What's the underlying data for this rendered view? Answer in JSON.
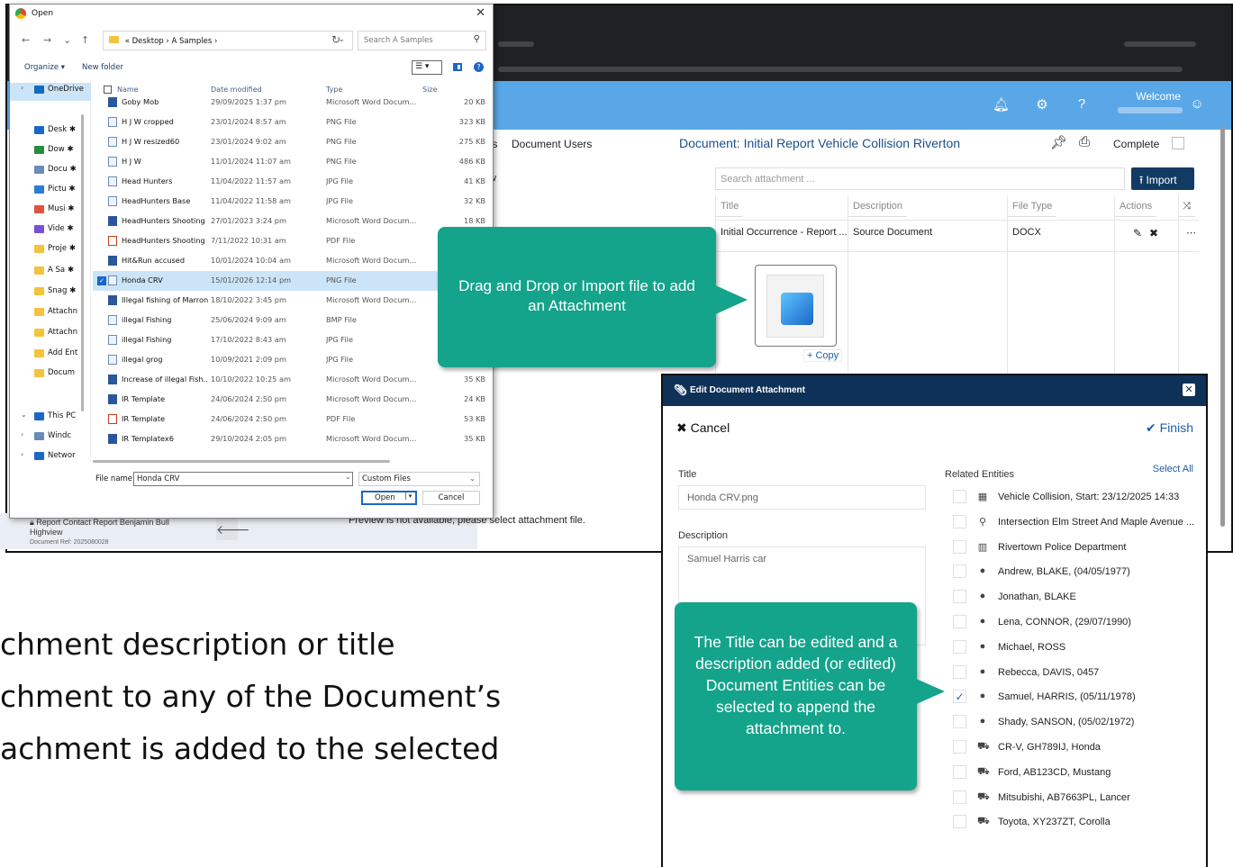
{
  "app": {
    "header": {
      "welcome": "Welcome"
    },
    "tabs": {
      "partial_tab": "ts",
      "document_users": "Document Users",
      "panel_letter": "w"
    },
    "document_title": "Document: Initial Report Vehicle Collision Riverton",
    "complete_label": "Complete",
    "search_placeholder": "Search attachment ...",
    "import_label": "Import",
    "table": {
      "headers": [
        "Title",
        "Description",
        "File Type",
        "Actions"
      ],
      "row": {
        "title": "Initial Occurrence - Report ...",
        "description": "Source Document",
        "file_type": "DOCX"
      }
    },
    "copy_label": "+ Copy",
    "footer": {
      "line1": "Report Contact Report Benjamin Bull",
      "line2": "Highview",
      "ref": "Document Ref: 2025080028"
    },
    "preview_message": "Preview is not available, please select attachment file."
  },
  "dialog": {
    "title": "Open",
    "breadcrumb": [
      "«",
      "Desktop",
      "›",
      "A Samples",
      "›"
    ],
    "search_placeholder": "Search A Samples",
    "organize": "Organize ▾",
    "new_folder": "New folder",
    "columns": {
      "name": "Name",
      "date": "Date modified",
      "type": "Type",
      "size": "Size"
    },
    "nav_items": [
      {
        "label": "OneDrive",
        "color": "#0f6cbd",
        "selected": true,
        "expander": "›"
      },
      {
        "label": "Desk ✱",
        "color": "#1a66c9"
      },
      {
        "label": "Dow ✱",
        "color": "#2b8a3e"
      },
      {
        "label": "Docu ✱",
        "color": "#6b8bb8"
      },
      {
        "label": "Pictu ✱",
        "color": "#2e7bd6"
      },
      {
        "label": "Musi ✱",
        "color": "#e0523f"
      },
      {
        "label": "Vide ✱",
        "color": "#7a4fd6"
      },
      {
        "label": "Proje ✱",
        "color": "#f3c33c"
      },
      {
        "label": "A Sa ✱",
        "color": "#f3c33c"
      },
      {
        "label": "Snag ✱",
        "color": "#f3c33c"
      },
      {
        "label": "Attachn",
        "color": "#f3c33c"
      },
      {
        "label": "Attachn",
        "color": "#f3c33c"
      },
      {
        "label": "Add Ent",
        "color": "#f3c33c"
      },
      {
        "label": "Docum",
        "color": "#f3c33c"
      },
      {
        "label": "This PC",
        "color": "#1a66c9",
        "expander": "⌄"
      },
      {
        "label": "Windc",
        "color": "#6b8bb8",
        "expander": "›"
      },
      {
        "label": "Networ",
        "color": "#1a66c9",
        "expander": "›"
      }
    ],
    "files": [
      {
        "name": "Goby Mob",
        "date": "29/09/2025 1:37 pm",
        "type": "Microsoft Word Docum...",
        "size": "20 KB",
        "kind": "word"
      },
      {
        "name": "H J W cropped",
        "date": "23/01/2024 8:57 am",
        "type": "PNG File",
        "size": "323 KB",
        "kind": "png"
      },
      {
        "name": "H J W resized60",
        "date": "23/01/2024 9:02 am",
        "type": "PNG File",
        "size": "275 KB",
        "kind": "png"
      },
      {
        "name": "H J W",
        "date": "11/01/2024 11:07 am",
        "type": "PNG File",
        "size": "486 KB",
        "kind": "png"
      },
      {
        "name": "Head Hunters",
        "date": "11/04/2022 11:57 am",
        "type": "JPG File",
        "size": "41 KB",
        "kind": "png"
      },
      {
        "name": "HeadHunters Base",
        "date": "11/04/2022 11:58 am",
        "type": "JPG File",
        "size": "32 KB",
        "kind": "png"
      },
      {
        "name": "HeadHunters Shooting",
        "date": "27/01/2023 3:24 pm",
        "type": "Microsoft Word Docum...",
        "size": "18 KB",
        "kind": "word"
      },
      {
        "name": "HeadHunters Shooting",
        "date": "7/11/2022 10:31 am",
        "type": "PDF File",
        "size": "",
        "kind": "pdf"
      },
      {
        "name": "Hit&Run accused",
        "date": "10/01/2024 10:04 am",
        "type": "Microsoft Word Docum...",
        "size": "",
        "kind": "word"
      },
      {
        "name": "Honda CRV",
        "date": "15/01/2026 12:14 pm",
        "type": "PNG File",
        "size": "",
        "kind": "png",
        "selected": true
      },
      {
        "name": "Illegal fishing of Marron",
        "date": "18/10/2022 3:45 pm",
        "type": "Microsoft Word Docum...",
        "size": "",
        "kind": "word"
      },
      {
        "name": "illegal Fishing",
        "date": "25/06/2024 9:09 am",
        "type": "BMP File",
        "size": "",
        "kind": "png"
      },
      {
        "name": "illegal Fishing",
        "date": "17/10/2022 8:43 am",
        "type": "JPG File",
        "size": "",
        "kind": "png"
      },
      {
        "name": "illegal grog",
        "date": "10/09/2021 2:09 pm",
        "type": "JPG File",
        "size": "",
        "kind": "png"
      },
      {
        "name": "Increase of illegal Fish...",
        "date": "10/10/2022 10:25 am",
        "type": "Microsoft Word Docum...",
        "size": "35 KB",
        "kind": "word"
      },
      {
        "name": "IR Template",
        "date": "24/06/2024 2:50 pm",
        "type": "Microsoft Word Docum...",
        "size": "24 KB",
        "kind": "word"
      },
      {
        "name": "IR Template",
        "date": "24/06/2024 2:50 pm",
        "type": "PDF File",
        "size": "53 KB",
        "kind": "pdf"
      },
      {
        "name": "IR Templatex6",
        "date": "29/10/2024 2:05 pm",
        "type": "Microsoft Word Docum...",
        "size": "35 KB",
        "kind": "word"
      }
    ],
    "file_name_label": "File name:",
    "file_name_value": "Honda CRV",
    "file_type_value": "Custom Files",
    "open_label": "Open",
    "cancel_label": "Cancel"
  },
  "callout_import": "Drag and Drop or Import file to add an Attachment",
  "edit_panel": {
    "title": "Edit Document Attachment",
    "cancel_label": "Cancel",
    "finish_label": "Finish",
    "title_label": "Title",
    "title_value": "Honda CRV.png",
    "description_label": "Description",
    "description_value": "Samuel Harris car",
    "related_label": "Related Entities",
    "select_all": "Select All",
    "entities": [
      {
        "label": "Vehicle Collision, Start: 23/12/2025 14:33",
        "icon": "▦",
        "icon_name": "incident-icon",
        "checked": false
      },
      {
        "label": "Intersection Elm Street And Maple Avenue ...",
        "icon": "⚲",
        "icon_name": "location-pin-icon",
        "checked": false
      },
      {
        "label": "Rivertown Police Department",
        "icon": "▥",
        "icon_name": "organisation-icon",
        "checked": false
      },
      {
        "label": "Andrew, BLAKE, (04/05/1977)",
        "icon": "●",
        "icon_name": "person-icon",
        "checked": false
      },
      {
        "label": "Jonathan, BLAKE",
        "icon": "●",
        "icon_name": "person-icon",
        "checked": false
      },
      {
        "label": "Lena, CONNOR, (29/07/1990)",
        "icon": "●",
        "icon_name": "person-icon",
        "checked": false
      },
      {
        "label": "Michael, ROSS",
        "icon": "●",
        "icon_name": "person-icon",
        "checked": false
      },
      {
        "label": "Rebecca, DAVIS, 0457",
        "icon": "●",
        "icon_name": "person-icon",
        "checked": false
      },
      {
        "label": "Samuel, HARRIS, (05/11/1978)",
        "icon": "●",
        "icon_name": "person-icon",
        "checked": true
      },
      {
        "label": "Shady, SANSON, (05/02/1972)",
        "icon": "●",
        "icon_name": "person-icon",
        "checked": false
      },
      {
        "label": "CR-V, GH789IJ, Honda",
        "icon": "⛟",
        "icon_name": "car-icon",
        "checked": false
      },
      {
        "label": "Ford, AB123CD, Mustang",
        "icon": "⛟",
        "icon_name": "car-icon",
        "checked": false
      },
      {
        "label": "Mitsubishi, AB7663PL, Lancer",
        "icon": "⛟",
        "icon_name": "car-icon",
        "checked": false
      },
      {
        "label": "Toyota, XY237ZT, Corolla",
        "icon": "⛟",
        "icon_name": "car-icon",
        "checked": false
      }
    ]
  },
  "callout_edit": "The Title can be edited and a description added (or edited) Document Entities can be selected to append the attachment to.",
  "slide_lines": [
    "chment description or title",
    "chment to any of the Document’s",
    "achment is added to the selected"
  ],
  "colors": {
    "header_blue": "#5aa7e8",
    "navy": "#0e3158",
    "callout_teal": "#14a38b",
    "link_blue": "#1b5fa8"
  }
}
